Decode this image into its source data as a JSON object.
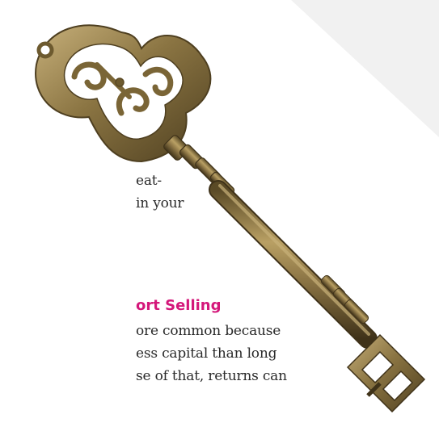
{
  "article": {
    "paragraph_fragment": [
      "eat-",
      "in your"
    ],
    "section_heading": "ort Selling",
    "section_body": [
      "ore common because",
      "ess capital than long",
      "se of that, returns can"
    ]
  },
  "illustration": {
    "subject": "antique skeleton key",
    "colors": {
      "metal_light": "#b39b63",
      "metal_mid": "#8a7442",
      "metal_dark": "#4e3f20",
      "background_corner": "#f1f1f1"
    }
  }
}
